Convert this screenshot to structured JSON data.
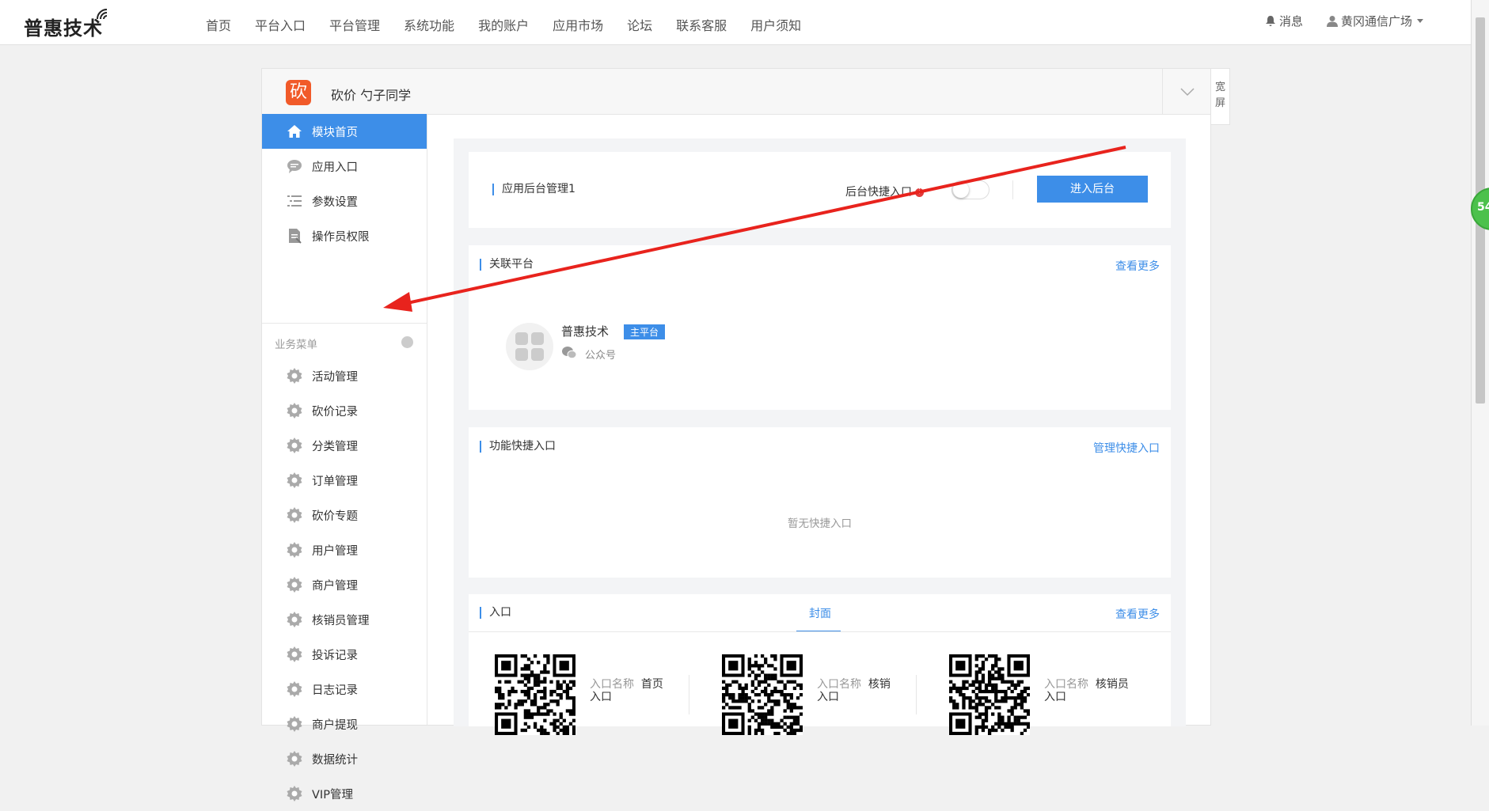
{
  "topbar": {
    "logo": "普惠技术",
    "nav": [
      "首页",
      "平台入口",
      "平台管理",
      "系统功能",
      "我的账户",
      "应用市场",
      "论坛",
      "联系客服",
      "用户须知"
    ],
    "messages": "消息",
    "user": "黄冈通信广场"
  },
  "panel": {
    "app_icon_char": "砍",
    "title": "砍价 勺子同学",
    "widescreen": "宽\n屏"
  },
  "sidebar": {
    "items": [
      {
        "label": "模块首页",
        "icon": "home-icon",
        "active": true
      },
      {
        "label": "应用入口",
        "icon": "chat-icon"
      },
      {
        "label": "参数设置",
        "icon": "list-icon"
      },
      {
        "label": "操作员权限",
        "icon": "document-icon"
      }
    ],
    "group_title": "业务菜单",
    "business_items": [
      "活动管理",
      "砍价记录",
      "分类管理",
      "订单管理",
      "砍价专题",
      "用户管理",
      "商户管理",
      "核销员管理",
      "投诉记录",
      "日志记录",
      "商户提现",
      "数据统计",
      "VIP管理"
    ]
  },
  "backend": {
    "title": "应用后台管理1",
    "shortcut_label": "后台快捷入口",
    "shortcut_info": "i",
    "toggle_on": false,
    "enter_button": "进入后台"
  },
  "related": {
    "title": "关联平台",
    "more": "查看更多",
    "platform_name": "普惠技术",
    "platform_badge": "主平台",
    "platform_type": "公众号"
  },
  "quick": {
    "title": "功能快捷入口",
    "manage": "管理快捷入口",
    "empty": "暂无快捷入口"
  },
  "entries": {
    "title": "入口",
    "tab": "封面",
    "more": "查看更多",
    "name_label": "入口名称",
    "items": [
      {
        "name": "首页",
        "suffix": "入口"
      },
      {
        "name": "核销",
        "suffix": "入口"
      },
      {
        "name": "核销员",
        "suffix": "入口"
      }
    ]
  },
  "floater": "54",
  "colors": {
    "accent": "#3d8ee8",
    "arrow": "#e8231d",
    "app_icon": "#f15a29"
  }
}
